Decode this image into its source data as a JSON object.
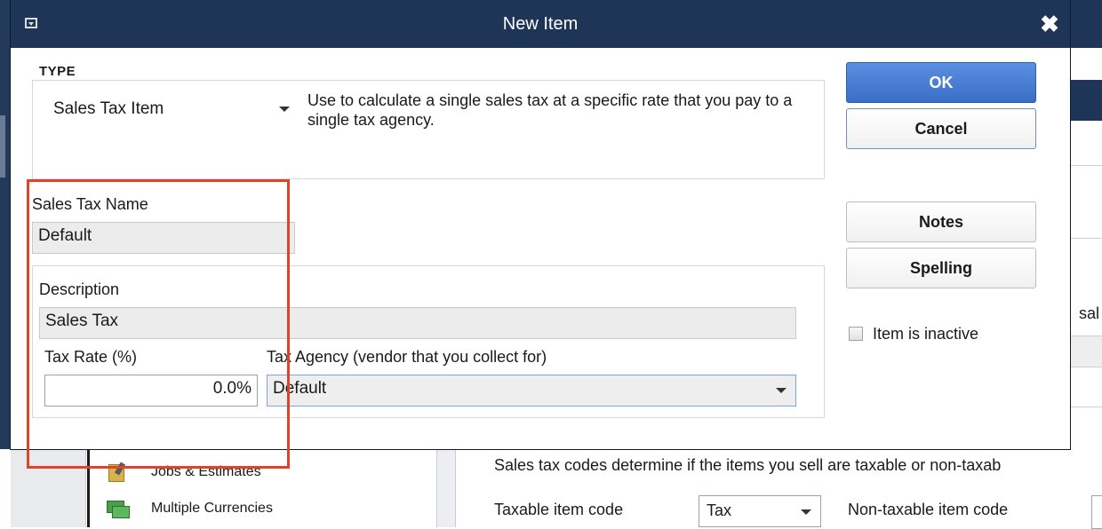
{
  "dialog": {
    "title": "New Item",
    "type": {
      "label": "TYPE",
      "selected": "Sales Tax Item",
      "description": "Use to calculate a single sales tax at a specific rate that you pay to a single tax agency."
    },
    "sales_tax_name": {
      "label": "Sales Tax Name",
      "value": "Default"
    },
    "description": {
      "label": "Description",
      "value": "Sales Tax"
    },
    "tax_rate": {
      "label": "Tax Rate (%)",
      "value": "0.0%"
    },
    "tax_agency": {
      "label": "Tax Agency (vendor that you collect for)",
      "value": "Default"
    },
    "buttons": {
      "ok": "OK",
      "cancel": "Cancel",
      "notes": "Notes",
      "spelling": "Spelling"
    },
    "inactive_checkbox": {
      "label": "Item is inactive",
      "checked": false
    }
  },
  "background": {
    "right_partial_text": "sal",
    "nav_items": [
      {
        "label": "Jobs & Estimates",
        "icon": "jobs-estimates-icon"
      },
      {
        "label": "Multiple Currencies",
        "icon": "multiple-currencies-icon"
      }
    ],
    "sales_tax_codes_text": "Sales tax codes determine if the items you sell are taxable or non-taxab",
    "taxable_item_code_label": "Taxable item code",
    "taxable_item_code_value": "Tax",
    "non_taxable_item_code_label": "Non-taxable item code"
  },
  "colors": {
    "titlebar": "#1f3558",
    "ok_button": "#3a6fc7",
    "highlight_box": "#e0432c"
  }
}
